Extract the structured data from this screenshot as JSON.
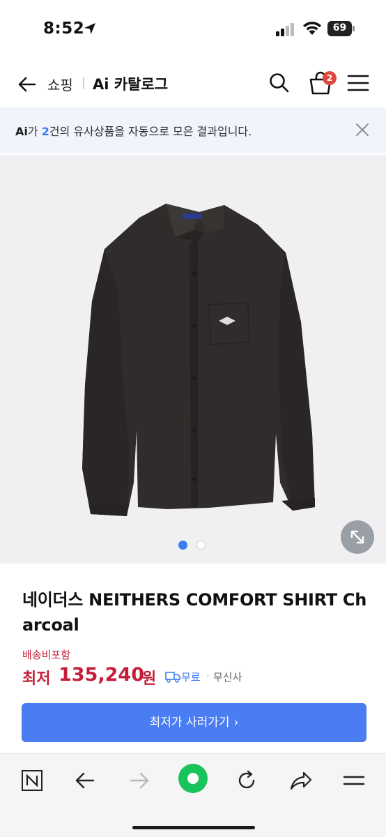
{
  "status_bar": {
    "time": "8:52",
    "battery": "69"
  },
  "header": {
    "shopping_label": "쇼핑",
    "title": "Ai 카탈로그",
    "cart_count": "2"
  },
  "notice": {
    "ai_mark": "Ai",
    "text_before": "가 ",
    "count": "2",
    "text_after": "건의 유사상품을 자동으로 모은 결과입니다."
  },
  "product": {
    "name": "네이더스 NEITHERS COMFORT SHIRT Charcoal",
    "image_tag": "NEITHERS",
    "shipping_note": "배송비포함",
    "price_label": "최저",
    "price": "135,240",
    "currency": "원",
    "delivery": "무료",
    "separator": "·",
    "seller": "무신사",
    "buy_button": "최저가 사러가기",
    "buy_chevron": "›"
  },
  "gallery": {
    "current_slide": 1,
    "total_slides": 2
  },
  "colors": {
    "accent_blue": "#3a7cf0",
    "button_blue": "#4a7cf2",
    "price_red": "#c41e3a",
    "badge_red": "#e0483e",
    "shirt_charcoal": "#2f2c2b"
  },
  "icons": {
    "status": [
      "location-arrow-icon",
      "signal-icon",
      "wifi-icon",
      "battery-icon"
    ],
    "header": [
      "back-arrow-icon",
      "search-icon",
      "cart-icon",
      "hamburger-menu-icon"
    ],
    "notice": [
      "close-icon"
    ],
    "gallery": [
      "expand-icon"
    ],
    "browser": [
      "naver-n-icon",
      "back-icon",
      "forward-icon",
      "green-home-icon",
      "refresh-icon",
      "share-icon",
      "menu-icon"
    ]
  }
}
